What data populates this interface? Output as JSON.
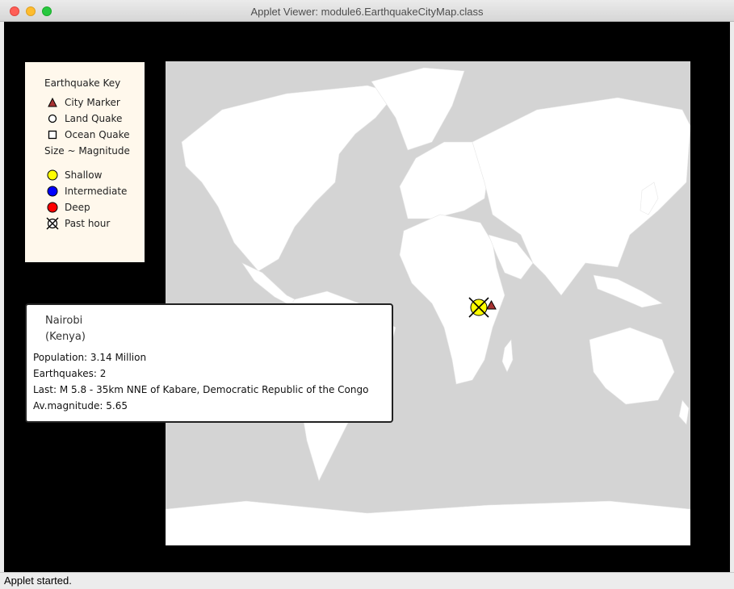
{
  "window": {
    "title": "Applet Viewer: module6.EarthquakeCityMap.class"
  },
  "status_bar": {
    "text": "Applet started."
  },
  "key": {
    "title": "Earthquake Key",
    "items": [
      {
        "label": "City Marker",
        "icon": "city-triangle-icon",
        "color": "#a83232"
      },
      {
        "label": "Land Quake",
        "icon": "circle-outline-icon"
      },
      {
        "label": "Ocean Quake",
        "icon": "square-outline-icon"
      },
      {
        "label": "Size ~ Magnitude"
      },
      {
        "label": "Shallow",
        "icon": "yellow-circle-icon",
        "color": "#ffff00"
      },
      {
        "label": "Intermediate",
        "icon": "blue-circle-icon",
        "color": "#0000ff"
      },
      {
        "label": "Deep",
        "icon": "red-circle-icon",
        "color": "#ff0000"
      },
      {
        "label": "Past hour",
        "icon": "crossed-circle-icon"
      }
    ]
  },
  "popup": {
    "city": "Nairobi",
    "country": "(Kenya)",
    "population": "Population: 3.14 Million",
    "earthquakes": "Earthquakes: 2",
    "last": "Last: M 5.8 - 35km NNE of Kabare, Democratic Republic of the Congo",
    "avg_magnitude": "Av.magnitude: 5.65"
  },
  "colors": {
    "map_ocean": "#d4d4d4",
    "map_land": "#ffffff",
    "applet_background": "#000000",
    "key_background": "#fff8ec",
    "shallow": "#ffff00",
    "intermediate": "#0000ff",
    "deep": "#ff0000",
    "city_marker": "#a83232"
  }
}
